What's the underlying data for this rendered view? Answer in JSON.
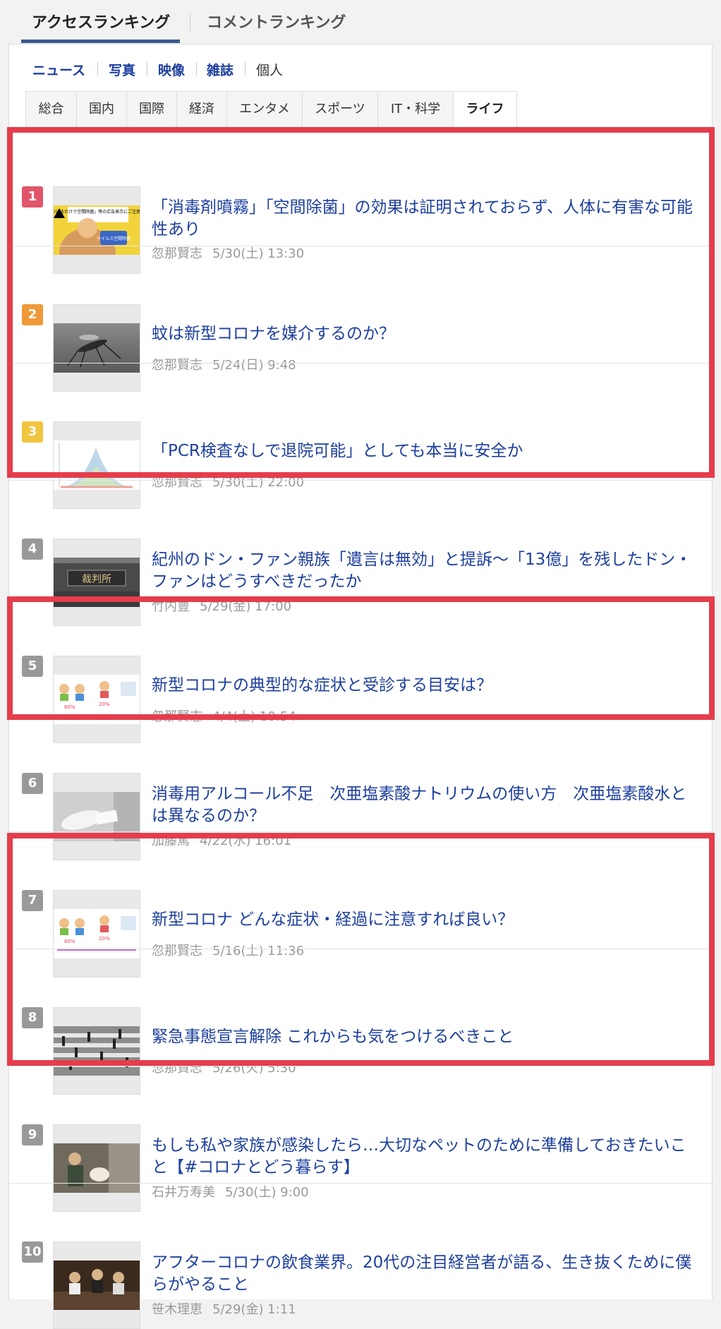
{
  "ranking_tabs": {
    "access": "アクセスランキング",
    "comment": "コメントランキング"
  },
  "categories": [
    "ニュース",
    "写真",
    "映像",
    "雑誌",
    "個人"
  ],
  "genres": [
    "総合",
    "国内",
    "国際",
    "経済",
    "エンタメ",
    "スポーツ",
    "IT・科学",
    "ライフ"
  ],
  "active_genre": "ライフ",
  "colors": {
    "highlight": "#e53d4b",
    "rank1": "#e0556a",
    "rank2": "#ef9a3a",
    "rank3": "#f2c540",
    "rank_other": "#999999",
    "link": "#1d3f9e"
  },
  "items": [
    {
      "rank": "1",
      "title": "「消毒剤噴霧」「空間除菌」の効果は証明されておらず、人体に有害な可能性あり",
      "author": "忽那賢志",
      "date": "5/30(土) 13:30"
    },
    {
      "rank": "2",
      "title": "蚊は新型コロナを媒介するのか？",
      "author": "忽那賢志",
      "date": "5/24(日) 9:48"
    },
    {
      "rank": "3",
      "title": "「PCR検査なしで退院可能」としても本当に安全か",
      "author": "忽那賢志",
      "date": "5/30(土) 22:00"
    },
    {
      "rank": "4",
      "title": "紀州のドン・ファン親族「遺言は無効」と提訴〜「13億」を残したドン・ファンはどうすべきだったか",
      "author": "竹内豊",
      "date": "5/29(金) 17:00"
    },
    {
      "rank": "5",
      "title": "新型コロナの典型的な症状と受診する目安は？",
      "author": "忽那賢志",
      "date": "4/4(土) 10:54"
    },
    {
      "rank": "6",
      "title": "消毒用アルコール不足　次亜塩素酸ナトリウムの使い方　次亜塩素酸水とは異なるのか？",
      "author": "加藤篤",
      "date": "4/22(水) 16:01"
    },
    {
      "rank": "7",
      "title": "新型コロナ どんな症状・経過に注意すれば良い？",
      "author": "忽那賢志",
      "date": "5/16(土) 11:36"
    },
    {
      "rank": "8",
      "title": "緊急事態宣言解除 これからも気をつけるべきこと",
      "author": "忽那賢志",
      "date": "5/26(火) 5:30"
    },
    {
      "rank": "9",
      "title": "もしも私や家族が感染したら…大切なペットのために準備しておきたいこと【#コロナとどう暮らす】",
      "author": "石井万寿美",
      "date": "5/30(土) 9:00"
    },
    {
      "rank": "10",
      "title": "アフターコロナの飲食業界。20代の注目経営者が語る、生き抜くために僕らがやること",
      "author": "笹木理恵",
      "date": "5/29(金) 1:11"
    }
  ],
  "thumb_texts": {
    "t1": "「鼻につけるだけで空間除菌」等の広告表示にご注意ください",
    "t1_badge": "ウイルス空間除菌",
    "t4": "裁判所"
  }
}
